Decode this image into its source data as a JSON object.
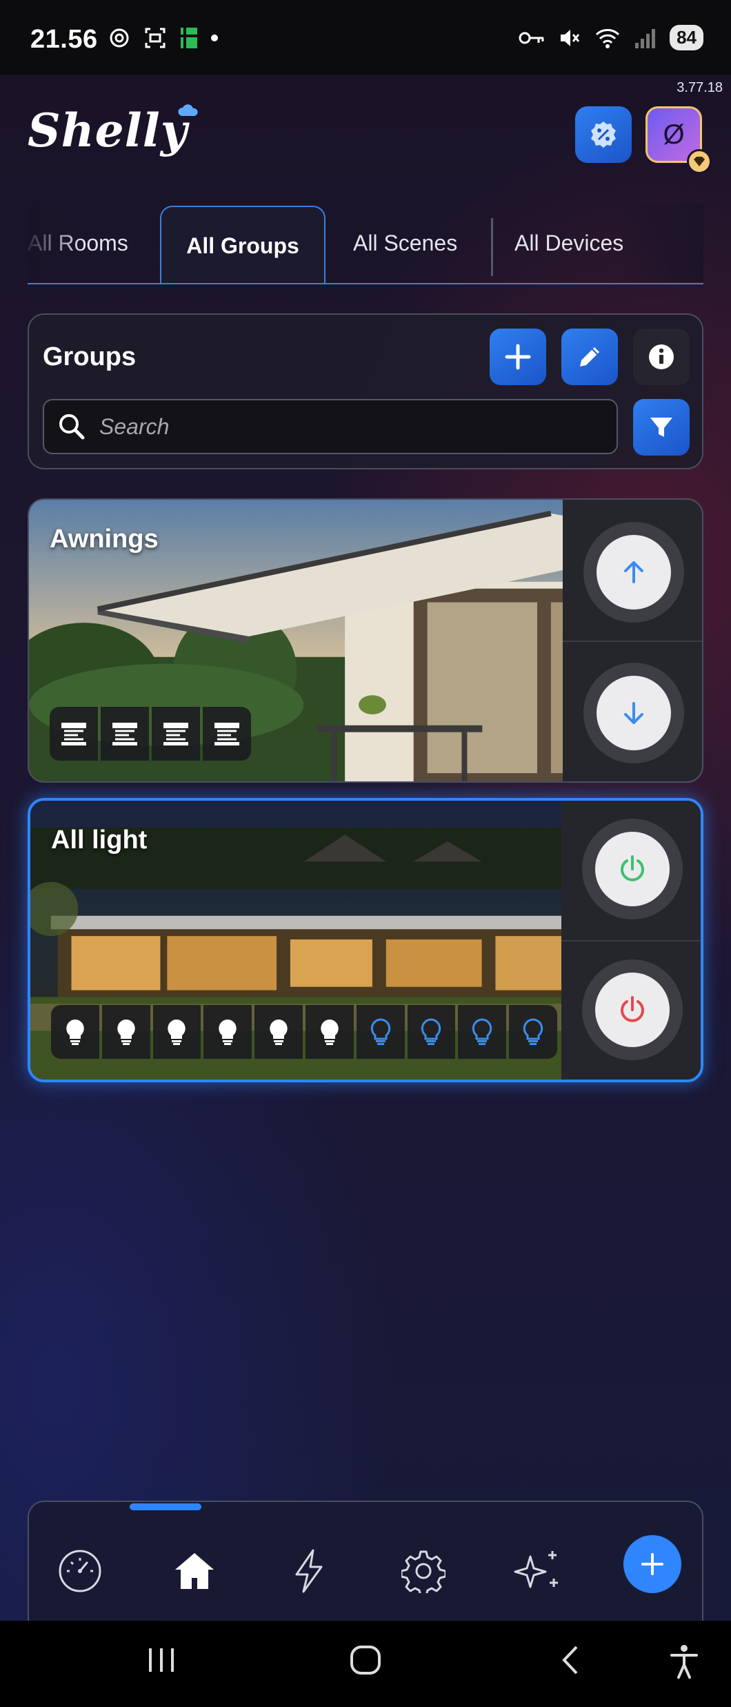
{
  "status_bar": {
    "time": "21.56",
    "battery": "84"
  },
  "header": {
    "version": "3.77.18",
    "logo_text": "Shelly"
  },
  "tabs": [
    {
      "label": "All Rooms",
      "active": false
    },
    {
      "label": "All Groups",
      "active": true
    },
    {
      "label": "All Scenes",
      "active": false
    },
    {
      "label": "All Devices",
      "active": false
    }
  ],
  "groups_panel": {
    "title": "Groups",
    "search_placeholder": "Search"
  },
  "groups": [
    {
      "name": "Awnings",
      "device_icons": [
        "awning-icon",
        "awning-icon",
        "awning-icon",
        "awning-icon"
      ],
      "controls": [
        "arrow-up-icon",
        "arrow-down-icon"
      ]
    },
    {
      "name": "All light",
      "device_icons": [
        "bulb-on-icon",
        "bulb-on-icon",
        "bulb-on-icon",
        "bulb-on-icon",
        "bulb-on-icon",
        "bulb-on-icon",
        "bulb-off-icon",
        "bulb-off-icon",
        "bulb-off-icon",
        "bulb-off-icon"
      ],
      "controls": [
        "power-on-icon",
        "power-off-icon"
      ]
    }
  ],
  "bottom_nav": [
    "dashboard-icon",
    "home-icon",
    "scenes-bolt-icon",
    "settings-gear-icon",
    "ai-sparkles-icon",
    "add-icon"
  ],
  "colors": {
    "accent": "#2f86ff",
    "power_on": "#3fbf6f",
    "power_off": "#e5484d",
    "premium_gold": "#f4c978"
  }
}
